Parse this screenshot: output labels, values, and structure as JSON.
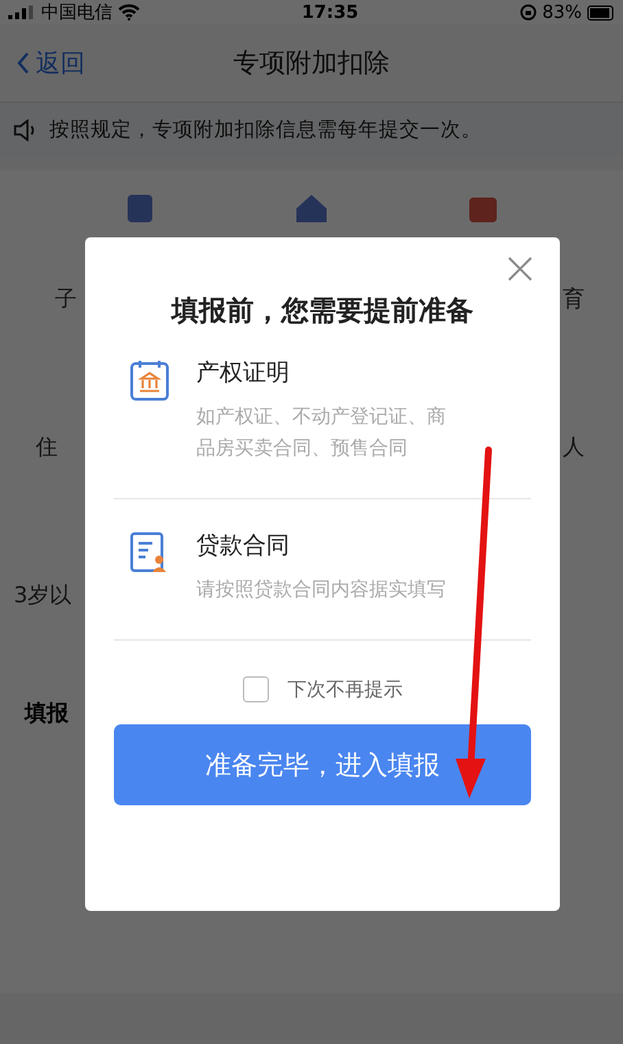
{
  "status_bar": {
    "carrier": "中国电信",
    "time": "17:35",
    "battery": "83%"
  },
  "nav": {
    "back": "返回",
    "title": "专项附加扣除"
  },
  "notice": "按照规定，专项附加扣除信息需每年提交一次。",
  "background_rows": [
    {
      "left": "子",
      "right": "育"
    },
    {
      "left": "住",
      "right": "人"
    },
    {
      "left": "3岁以",
      "right": ""
    }
  ],
  "section_title": "填报",
  "dialog": {
    "title": "填报前，您需要提前准备",
    "items": [
      {
        "kind": "deed",
        "title": "产权证明",
        "description": "如产权证、不动产登记证、商品房买卖合同、预售合同"
      },
      {
        "kind": "contract",
        "title": "贷款合同",
        "description": "请按照贷款合同内容据实填写"
      }
    ],
    "dont_remind": {
      "label": "下次不再提示",
      "checked": false
    },
    "confirm": "准备完毕，进入填报"
  }
}
